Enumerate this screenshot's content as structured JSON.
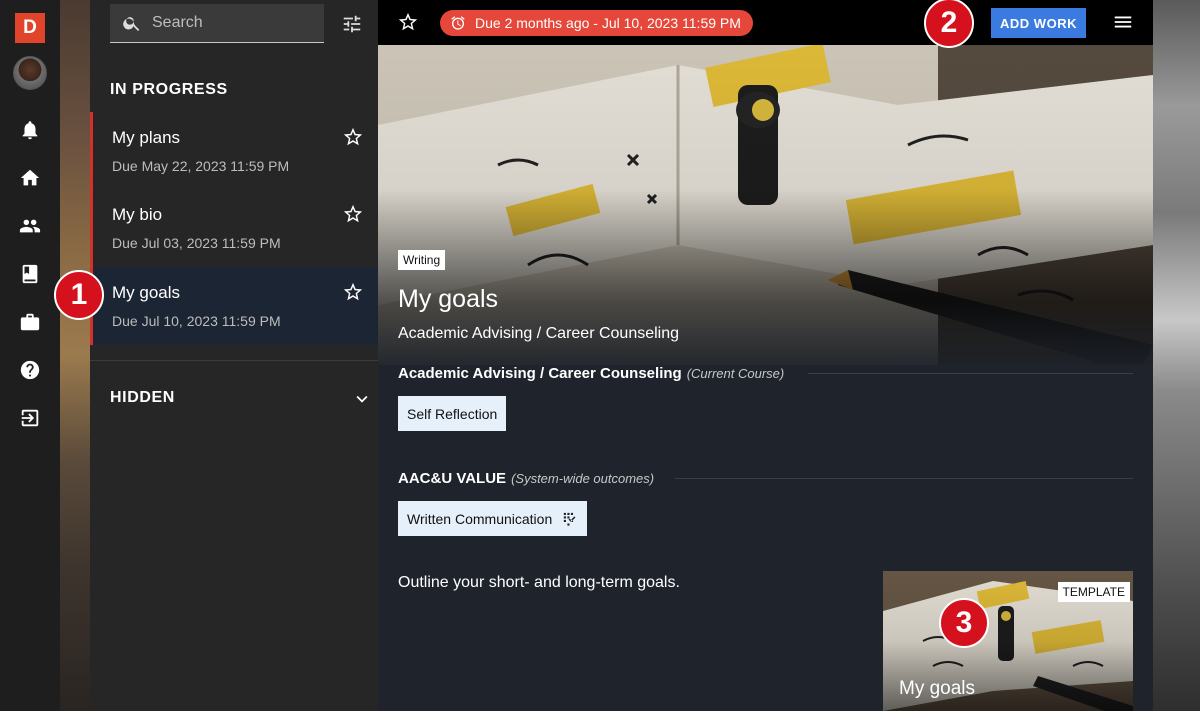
{
  "app": {
    "logo_letter": "D"
  },
  "rail": {
    "items": [
      "bell-icon",
      "home-icon",
      "people-icon",
      "book-icon",
      "briefcase-icon",
      "help-icon",
      "logout-icon"
    ]
  },
  "search": {
    "placeholder": "Search"
  },
  "sections": {
    "in_progress": "IN PROGRESS",
    "hidden": "HIDDEN"
  },
  "works": [
    {
      "title": "My plans",
      "due": "Due May 22, 2023 11:59 PM",
      "selected": false
    },
    {
      "title": "My bio",
      "due": "Due Jul 03, 2023 11:59 PM",
      "selected": false
    },
    {
      "title": "My goals",
      "due": "Due Jul 10, 2023 11:59 PM",
      "selected": true
    }
  ],
  "topbar": {
    "due_pill": "Due 2 months ago - Jul 10, 2023 11:59 PM",
    "add_work_label": "ADD WORK"
  },
  "hero": {
    "tag": "Writing",
    "title": "My goals",
    "subtitle": "Academic Advising / Career Counseling"
  },
  "outcomes": [
    {
      "heading": "Academic Advising / Career Counseling",
      "note": "(Current Course)",
      "chip": "Self Reflection"
    },
    {
      "heading": "AAC&U VALUE",
      "note": "(System-wide outcomes)",
      "chip": "Written Communication"
    }
  ],
  "description": "Outline your short- and long-term goals.",
  "template_card": {
    "tag": "TEMPLATE",
    "title": "My goals"
  },
  "callouts": [
    "1",
    "2",
    "3"
  ],
  "colors": {
    "accent_red": "#e5473a",
    "add_work_blue": "#3b7be0",
    "logo_orange": "#e0452b",
    "callout_red": "#d4111d",
    "selected_row": "#1c2533"
  }
}
